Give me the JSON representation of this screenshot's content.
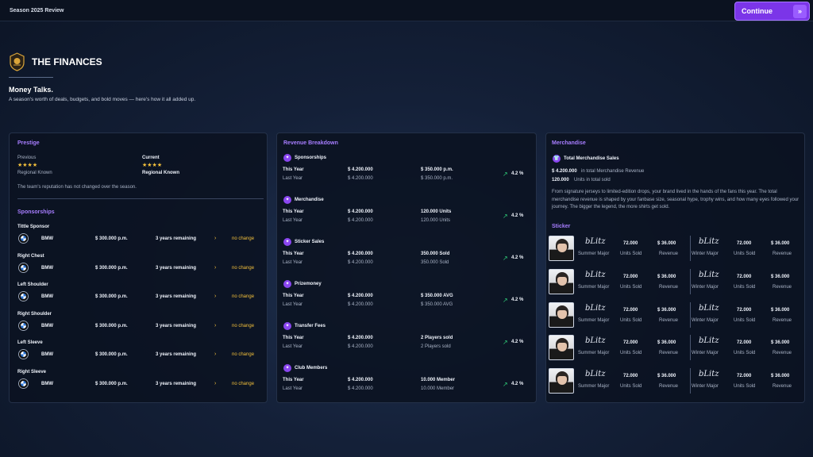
{
  "topbar": {
    "season_label": "Season  2025  Review",
    "continue_label": "Continue",
    "continue_icon": "double-chevron-right-icon"
  },
  "header": {
    "title": "THE FINANCES",
    "tagline": "Money Talks.",
    "subline": "A season's worth of deals, budgets, and bold moves — here's how it all added up."
  },
  "prestige": {
    "title": "Prestige",
    "previous_label": "Previous",
    "previous_stars": "★★★★",
    "previous_rating": 4,
    "previous_value": "Regional Known",
    "current_label": "Current",
    "current_stars": "★★★★",
    "current_rating": 4,
    "current_value": "Regional Known",
    "note": "The team's reputation has not changed over the season."
  },
  "sponsorships": {
    "title": "Sponsorships",
    "items": [
      {
        "slot": "Tittle Sponsor",
        "brand": "BMW",
        "amount": "$ 300.000  p.m.",
        "remaining": "3 years remaining",
        "status": "no change"
      },
      {
        "slot": "Right Chest",
        "brand": "BMW",
        "amount": "$ 300.000  p.m.",
        "remaining": "3 years remaining",
        "status": "no change"
      },
      {
        "slot": "Left Shoulder",
        "brand": "BMW",
        "amount": "$ 300.000  p.m.",
        "remaining": "3 years remaining",
        "status": "no change"
      },
      {
        "slot": "Right Shoulder",
        "brand": "BMW",
        "amount": "$ 300.000  p.m.",
        "remaining": "3 years remaining",
        "status": "no change"
      },
      {
        "slot": "Left Sleeve",
        "brand": "BMW",
        "amount": "$ 300.000  p.m.",
        "remaining": "3 years remaining",
        "status": "no change"
      },
      {
        "slot": "Right Sleeve",
        "brand": "BMW",
        "amount": "$ 300.000  p.m.",
        "remaining": "3 years remaining",
        "status": "no change"
      }
    ]
  },
  "revenue": {
    "title": "Revenue Breakdown",
    "this_year_label": "This Year",
    "last_year_label": "Last Year",
    "items": [
      {
        "name": "Sponsorships",
        "icon": "handshake-icon",
        "this_amount": "$ 4.200.000",
        "last_amount": "$ 4.200.000",
        "this_detail": "$ 350.000  p.m.",
        "last_detail": "$ 350.000  p.m.",
        "change": "4.2  %"
      },
      {
        "name": "Merchandise",
        "icon": "shirt-icon",
        "this_amount": "$ 4.200.000",
        "last_amount": "$ 4.200.000",
        "this_detail": "120.000  Units",
        "last_detail": "120.000  Units",
        "change": "4.2  %"
      },
      {
        "name": "Sticker Sales",
        "icon": "sticker-icon",
        "this_amount": "$ 4.200.000",
        "last_amount": "$ 4.200.000",
        "this_detail": "350.000  Sold",
        "last_detail": "350.000  Sold",
        "change": "4.2  %"
      },
      {
        "name": "Prizemoney",
        "icon": "trophy-icon",
        "this_amount": "$ 4.200.000",
        "last_amount": "$ 4.200.000",
        "this_detail": "$ 350.000  AVG",
        "last_detail": "$ 350.000  AVG",
        "change": "4.2  %"
      },
      {
        "name": "Transfer Fees",
        "icon": "transfer-trophy-icon",
        "this_amount": "$ 4.200.000",
        "last_amount": "$ 4.200.000",
        "this_detail": "2  Players sold",
        "last_detail": "2  Players sold",
        "change": "4.2  %"
      },
      {
        "name": "Club Members",
        "icon": "members-icon",
        "this_amount": "$ 4.200.000",
        "last_amount": "$ 4.200.000",
        "this_detail": "10.000  Member",
        "last_detail": "10.000  Member",
        "change": "4.2  %"
      }
    ]
  },
  "merchandise": {
    "title": "Merchandise",
    "total_label": "Total Merchandise Sales",
    "revenue_value": "$ 4.200.000",
    "revenue_suffix": "in total Merchandise Revenue",
    "units_value": "120.000",
    "units_suffix": "Units in total sold",
    "description": "From signature jerseys to limited-edition drops, your brand lived in the hands of the fans this year. The total merchandise revenue is shaped by your fanbase size, seasonal hype, trophy wins, and how many eyes followed your journey. The bigger the legend, the more shirts get sold."
  },
  "sticker": {
    "title": "Sticker",
    "rows": [
      {
        "left": {
          "signature": "bLitz",
          "event": "Summer Major",
          "units": "72.000",
          "units_label": "Units Sold",
          "revenue": "$ 36.000",
          "revenue_label": "Revenue"
        },
        "right": {
          "signature": "bLitz",
          "event": "Winter Major",
          "units": "72.000",
          "units_label": "Units Sold",
          "revenue": "$ 36.000",
          "revenue_label": "Revenue"
        }
      },
      {
        "left": {
          "signature": "bLitz",
          "event": "Summer Major",
          "units": "72.000",
          "units_label": "Units Sold",
          "revenue": "$ 36.000",
          "revenue_label": "Revenue"
        },
        "right": {
          "signature": "bLitz",
          "event": "Winter Major",
          "units": "72.000",
          "units_label": "Units Sold",
          "revenue": "$ 36.000",
          "revenue_label": "Revenue"
        }
      },
      {
        "left": {
          "signature": "bLitz",
          "event": "Summer Major",
          "units": "72.000",
          "units_label": "Units Sold",
          "revenue": "$ 36.000",
          "revenue_label": "Revenue"
        },
        "right": {
          "signature": "bLitz",
          "event": "Winter Major",
          "units": "72.000",
          "units_label": "Units Sold",
          "revenue": "$ 36.000",
          "revenue_label": "Revenue"
        }
      },
      {
        "left": {
          "signature": "bLitz",
          "event": "Summer Major",
          "units": "72.000",
          "units_label": "Units Sold",
          "revenue": "$ 36.000",
          "revenue_label": "Revenue"
        },
        "right": {
          "signature": "bLitz",
          "event": "Winter Major",
          "units": "72.000",
          "units_label": "Units Sold",
          "revenue": "$ 36.000",
          "revenue_label": "Revenue"
        }
      },
      {
        "left": {
          "signature": "bLitz",
          "event": "Summer Major",
          "units": "72.000",
          "units_label": "Units Sold",
          "revenue": "$ 36.000",
          "revenue_label": "Revenue"
        },
        "right": {
          "signature": "bLitz",
          "event": "Winter Major",
          "units": "72.000",
          "units_label": "Units Sold",
          "revenue": "$ 36.000",
          "revenue_label": "Revenue"
        }
      }
    ]
  },
  "colors": {
    "accent": "#7b35e8",
    "section_title": "#a77dff",
    "star": "#f3c03b",
    "positive": "#2fd07a",
    "warning": "#f3c03b"
  }
}
